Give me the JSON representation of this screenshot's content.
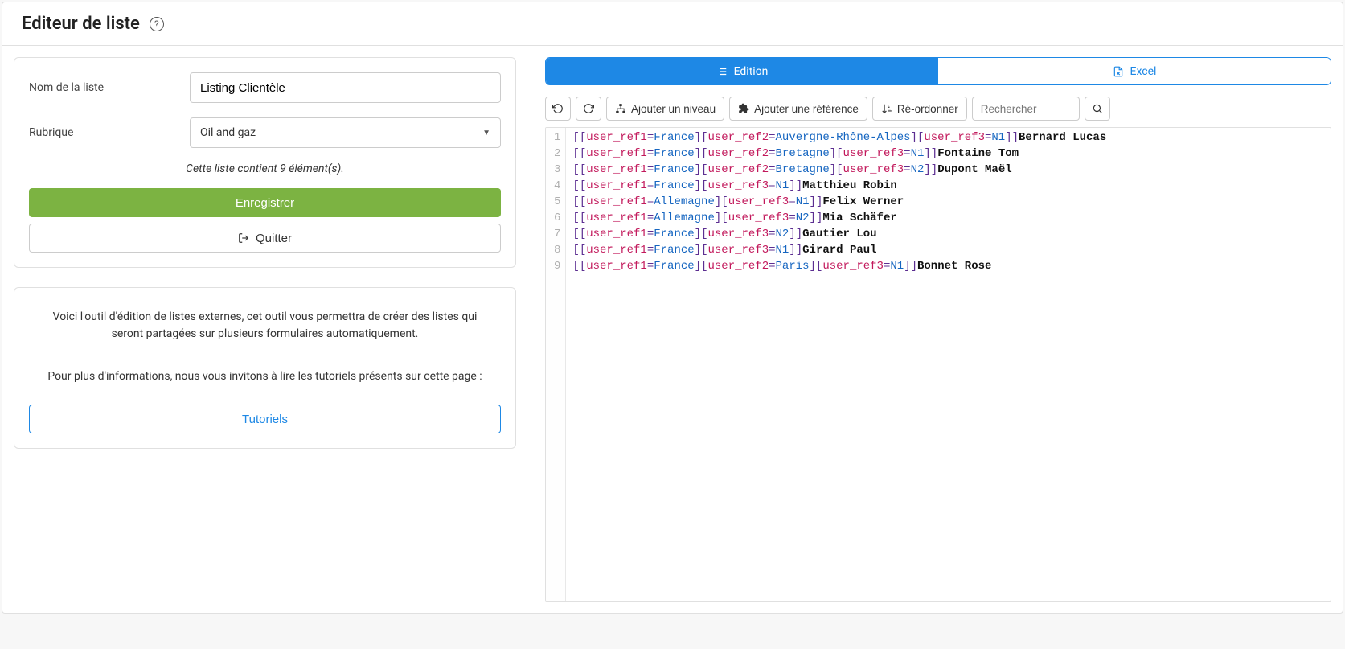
{
  "page": {
    "title": "Editeur de liste"
  },
  "form": {
    "name_label": "Nom de la liste",
    "name_value": "Listing Clientèle",
    "category_label": "Rubrique",
    "category_value": "Oil and gaz",
    "item_count_text": "Cette liste contient 9 élément(s).",
    "save_label": "Enregistrer",
    "quit_label": "Quitter"
  },
  "info": {
    "line1": "Voici l'outil d'édition de listes externes, cet outil vous permettra de créer des listes qui seront partagées sur plusieurs formulaires automatiquement.",
    "line2": "Pour plus d'informations, nous vous invitons à lire les tutoriels présents sur cette page :",
    "tutorials_label": "Tutoriels"
  },
  "tabs": {
    "edition": "Edition",
    "excel": "Excel"
  },
  "toolbar": {
    "add_level": "Ajouter un niveau",
    "add_reference": "Ajouter une référence",
    "reorder": "Ré-ordonner",
    "search_placeholder": "Rechercher"
  },
  "editor": {
    "lines": [
      {
        "refs": [
          [
            "user_ref1",
            "France"
          ],
          [
            "user_ref2",
            "Auvergne-Rhône-Alpes"
          ],
          [
            "user_ref3",
            "N1"
          ]
        ],
        "name": "Bernard Lucas"
      },
      {
        "refs": [
          [
            "user_ref1",
            "France"
          ],
          [
            "user_ref2",
            "Bretagne"
          ],
          [
            "user_ref3",
            "N1"
          ]
        ],
        "name": "Fontaine Tom"
      },
      {
        "refs": [
          [
            "user_ref1",
            "France"
          ],
          [
            "user_ref2",
            "Bretagne"
          ],
          [
            "user_ref3",
            "N2"
          ]
        ],
        "name": "Dupont Maël"
      },
      {
        "refs": [
          [
            "user_ref1",
            "France"
          ],
          [
            "user_ref3",
            "N1"
          ]
        ],
        "name": "Matthieu Robin"
      },
      {
        "refs": [
          [
            "user_ref1",
            "Allemagne"
          ],
          [
            "user_ref3",
            "N1"
          ]
        ],
        "name": "Felix Werner"
      },
      {
        "refs": [
          [
            "user_ref1",
            "Allemagne"
          ],
          [
            "user_ref3",
            "N2"
          ]
        ],
        "name": "Mia Schäfer"
      },
      {
        "refs": [
          [
            "user_ref1",
            "France"
          ],
          [
            "user_ref3",
            "N2"
          ]
        ],
        "name": "Gautier Lou"
      },
      {
        "refs": [
          [
            "user_ref1",
            "France"
          ],
          [
            "user_ref3",
            "N1"
          ]
        ],
        "name": "Girard Paul"
      },
      {
        "refs": [
          [
            "user_ref1",
            "France"
          ],
          [
            "user_ref2",
            "Paris"
          ],
          [
            "user_ref3",
            "N1"
          ]
        ],
        "name": "Bonnet Rose"
      }
    ]
  }
}
